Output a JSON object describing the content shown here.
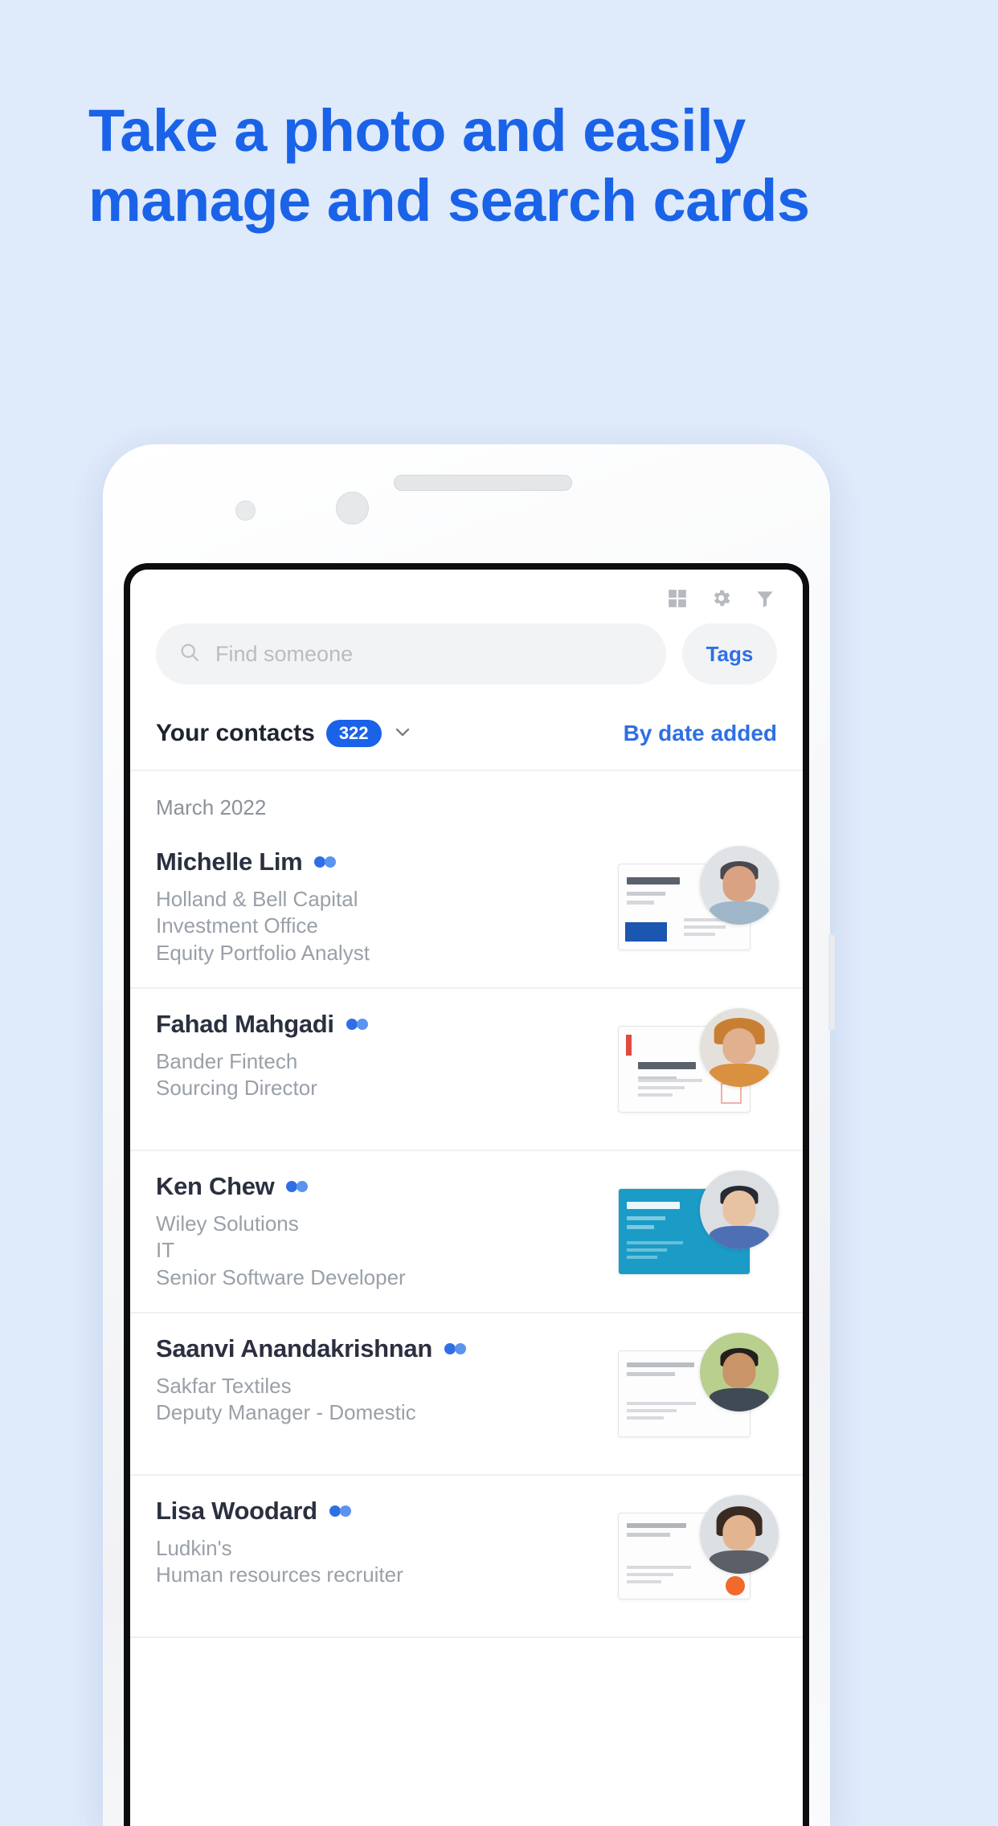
{
  "headline": "Take a photo and easily manage and search cards",
  "colors": {
    "page_bg": "#dfeafb",
    "headline_blue": "#1a63e8",
    "accent_blue": "#2f6fe4",
    "badge_blue": "#1a63e8"
  },
  "toolbar": {
    "icons": [
      "grid-view-icon",
      "gear-icon",
      "filter-icon"
    ]
  },
  "search": {
    "placeholder": "Find someone",
    "icon": "search-icon",
    "tags_label": "Tags"
  },
  "contacts_header": {
    "title": "Your contacts",
    "count": "322",
    "chevron": "chevron-down-icon",
    "sort_label": "By date added"
  },
  "month_label": "March 2022",
  "contacts": [
    {
      "name": "Michelle Lim",
      "company": "Holland & Bell Capital",
      "department": "Investment Office",
      "role": "Equity Portfolio Analyst",
      "card_style": "blue-block",
      "avatar_tone": "male-light"
    },
    {
      "name": "Fahad Mahgadi",
      "company": "Bander Fintech",
      "department": "",
      "role": "Sourcing Director",
      "card_style": "red-accent",
      "avatar_tone": "female-hat"
    },
    {
      "name": "Ken Chew",
      "company": "Wiley Solutions",
      "department": "IT",
      "role": "Senior Software Developer",
      "card_style": "teal",
      "avatar_tone": "male-dark"
    },
    {
      "name": "Saanvi Anandakrishnan",
      "company": "Sakfar Textiles",
      "department": "",
      "role": "Deputy Manager - Domestic",
      "card_style": "plain",
      "avatar_tone": "green-bg"
    },
    {
      "name": "Lisa Woodard",
      "company": "Ludkin's",
      "department": "",
      "role": "Human resources recruiter",
      "card_style": "plain-dot",
      "avatar_tone": "female-dark"
    }
  ]
}
